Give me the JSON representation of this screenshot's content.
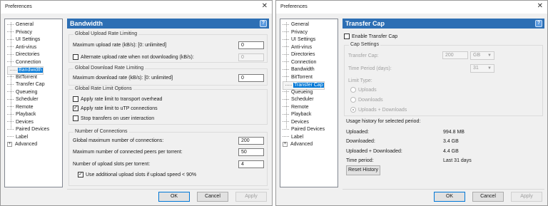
{
  "left": {
    "window_title": "Preferences",
    "tree": [
      "General",
      "Privacy",
      "UI Settings",
      "Anti-virus",
      "Directories",
      "Connection",
      "Bandwidth",
      "BitTorrent",
      "Transfer Cap",
      "Queueing",
      "Scheduler",
      "Remote",
      "Playback",
      "Devices",
      "Paired Devices",
      "Label",
      "Advanced"
    ],
    "selected": "Bandwidth",
    "panel_title": "Bandwidth",
    "help": "?",
    "upload": {
      "group": "Global Upload Rate Limiting",
      "max_label": "Maximum upload rate (kB/s): [0: unlimited]",
      "max_value": "0",
      "alt_label": "Alternate upload rate when not downloading (kB/s):",
      "alt_value": "0"
    },
    "download": {
      "group": "Global Download Rate Limiting",
      "max_label": "Maximum download rate (kB/s): [0: unlimited]",
      "max_value": "0"
    },
    "options": {
      "group": "Global Rate Limit Options",
      "opt1": "Apply rate limit to transport overhead",
      "opt2": "Apply rate limit to uTP connections",
      "opt3": "Stop transfers on user interaction"
    },
    "connections": {
      "group": "Number of Connections",
      "global_label": "Global maximum number of connections:",
      "global_value": "200",
      "peers_label": "Maximum number of connected peers per torrent:",
      "peers_value": "50",
      "slots_label": "Number of upload slots per torrent:",
      "slots_value": "4",
      "extra_label": "Use additional upload slots if upload speed < 90%"
    },
    "ok": "OK",
    "cancel": "Cancel",
    "apply": "Apply"
  },
  "right": {
    "window_title": "Preferences",
    "tree": [
      "General",
      "Privacy",
      "UI Settings",
      "Anti-virus",
      "Directories",
      "Connection",
      "Bandwidth",
      "BitTorrent",
      "Transfer Cap",
      "Queueing",
      "Scheduler",
      "Remote",
      "Playback",
      "Devices",
      "Paired Devices",
      "Label",
      "Advanced"
    ],
    "selected": "Transfer Cap",
    "panel_title": "Transfer Cap",
    "help": "?",
    "enable_label": "Enable Transfer Cap",
    "cap": {
      "group": "Cap Settings",
      "transfer_cap_label": "Transfer Cap:",
      "transfer_cap_value": "200",
      "unit": "GB",
      "period_label": "Time Period (days):",
      "period_value": "31",
      "limit_type_label": "Limit Type:",
      "r1": "Uploads",
      "r2": "Downloads",
      "r3": "Uploads + Downloads"
    },
    "usage": {
      "heading": "Usage history for selected period:",
      "uploaded_label": "Uploaded:",
      "uploaded": "994.8 MB",
      "downloaded_label": "Downloaded:",
      "downloaded": "3.4 GB",
      "total_label": "Uploaded + Downloaded:",
      "total": "4.4 GB",
      "period_label": "Time period:",
      "period": "Last 31 days",
      "reset": "Reset History"
    },
    "ok": "OK",
    "cancel": "Cancel",
    "apply": "Apply"
  }
}
